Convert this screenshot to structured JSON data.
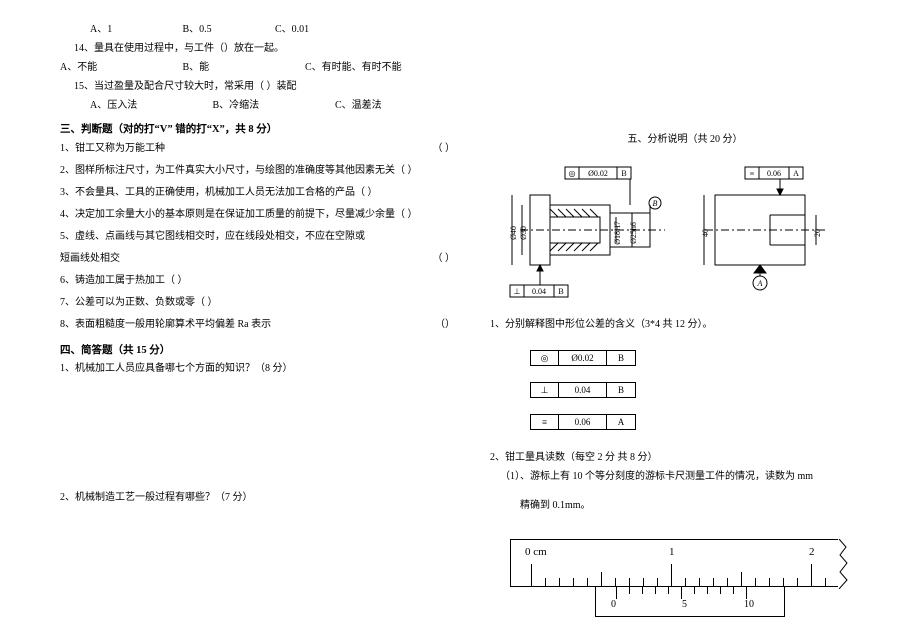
{
  "left": {
    "q13_opts": [
      "A、1",
      "B、0.5",
      "C、0.01"
    ],
    "q14": "14、量具在使用过程中，与工件（）放在一起。",
    "q14_opts": [
      "A、不能",
      "B、能",
      "C、有时能、有时不能"
    ],
    "q15": "15、当过盈量及配合尺寸较大时，常采用（    ）装配",
    "q15_opts": [
      "A、压入法",
      "B、冷缩法",
      "C、温差法"
    ],
    "sec3_title": "三、判断题（对的打“V” 错的打“X”，共 8 分）",
    "judge": [
      "1、钳工又称为万能工种",
      "2、图样所标注尺寸，为工件真实大小尺寸，与绘图的准确度等其他因素无关（    ）",
      "3、不会量具、工具的正确使用，机械加工人员无法加工合格的产品（    ）",
      "4、决定加工余量大小的基本原则是在保证加工质量的前提下，尽量减少余量（    ）",
      "5、虚线、点画线与其它图线相交时，应在线段处相交，不应在空隙或",
      "    短画线处相交",
      "6、铸造加工属于热加工（    ）",
      "7、公差可以为正数、负数或零（    ）",
      "8、表面粗糙度一般用轮廓算术平均偏差 Ra 表示"
    ],
    "paren_text": "（       ）",
    "paren_text2": "（）",
    "sec4_title": "四、简答题（共 15 分）",
    "sa1": "1、机械加工人员应具备哪七个方面的知识？（8 分）",
    "sa2": "2、机械制造工艺一般过程有哪些？（7 分）"
  },
  "right": {
    "sec5_title": "五、分析说明（共 20 分）",
    "fig_labels": {
      "tol_top1_sym": "◎",
      "tol_top1_val": "Ø0.02",
      "tol_top1_ref": "B",
      "datum_b": "B",
      "d40": "Ø40",
      "d30": "Ø30",
      "d18": "Ø18H7",
      "d25": "Ø25h6",
      "tol_perp_sym": "⊥",
      "tol_perp_val": "0.04",
      "tol_perp_ref": "B",
      "tol_par_sym": "≡",
      "tol_par_val": "0.06",
      "tol_par_ref": "A",
      "dim40": "40",
      "dim20": "20",
      "datum_a": "A"
    },
    "q1": "1、分别解释图中形位公差的含义（3*4 共 12 分）。",
    "tolbox": [
      {
        "sym": "◎",
        "val": "Ø0.02",
        "ref": "B"
      },
      {
        "sym": "⊥",
        "val": "0.04",
        "ref": "B"
      },
      {
        "sym": "≡",
        "val": "0.06",
        "ref": "A"
      }
    ],
    "q2": "2、钳工量具读数（每空 2 分 共 8 分）",
    "q2a": "（1）、游标上有 10 个等分刻度的游标卡尺测量工件的情况，读数为 mm",
    "q2_note": "精确到 0.1mm。",
    "ruler_main": {
      "lbl0": "0 cm",
      "lbl1": "1",
      "lbl2": "2"
    },
    "vernier": {
      "lbl0": "0",
      "lbl5": "5",
      "lbl10": "10"
    }
  }
}
